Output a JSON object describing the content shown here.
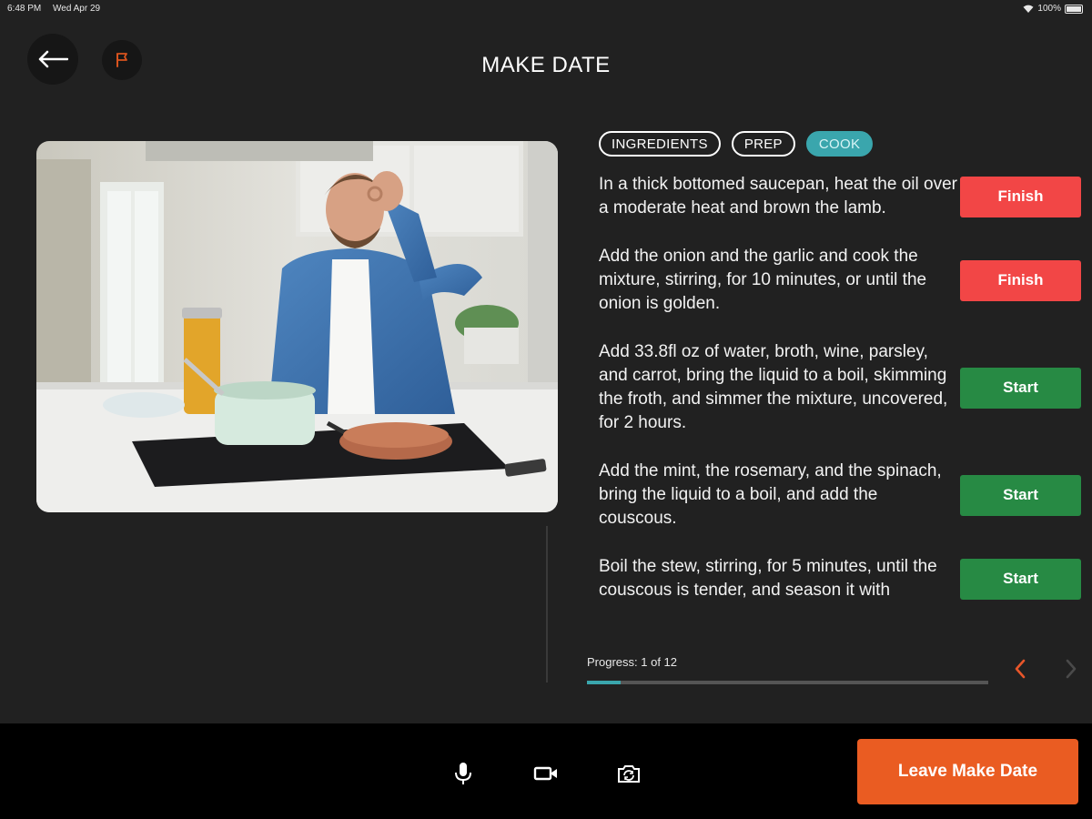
{
  "status_bar": {
    "time": "6:48 PM",
    "date": "Wed Apr 29",
    "battery": "100%"
  },
  "header": {
    "title": "MAKE DATE"
  },
  "colors": {
    "accent_teal": "#3aa6ad",
    "finish_red": "#f24646",
    "start_green": "#278a44",
    "leave_orange": "#ea5c22",
    "background": "#212121"
  },
  "tabs": [
    {
      "label": "INGREDIENTS",
      "active": false
    },
    {
      "label": "PREP",
      "active": false
    },
    {
      "label": "COOK",
      "active": true
    }
  ],
  "steps": [
    {
      "text": "In a thick bottomed saucepan, heat the oil over a moderate heat and brown the lamb.",
      "button": "Finish"
    },
    {
      "text": "Add the onion and the garlic and cook the mixture, stirring, for 10 minutes, or until the onion is golden.",
      "button": "Finish"
    },
    {
      "text": "Add 33.8fl oz of water, broth, wine, parsley, and carrot, bring the liquid to a boil, skimming the froth, and simmer the mixture, uncovered, for 2 hours.",
      "button": "Start"
    },
    {
      "text": "Add the mint, the rosemary, and the spinach, bring the liquid to a boil, and add the couscous.",
      "button": "Start"
    },
    {
      "text": "Boil the stew, stirring, for 5 minutes, until the couscous is tender, and season it with",
      "button": "Start"
    }
  ],
  "progress": {
    "label": "Progress: 1 of 12",
    "current": 1,
    "total": 12
  },
  "icons": {
    "back": "back-arrow-icon",
    "flag": "flag-icon",
    "prev": "chevron-left-icon",
    "next": "chevron-right-icon",
    "mic": "microphone-icon",
    "video": "video-camera-icon",
    "switch_camera": "switch-camera-icon"
  },
  "footer": {
    "leave_label": "Leave Make Date"
  }
}
